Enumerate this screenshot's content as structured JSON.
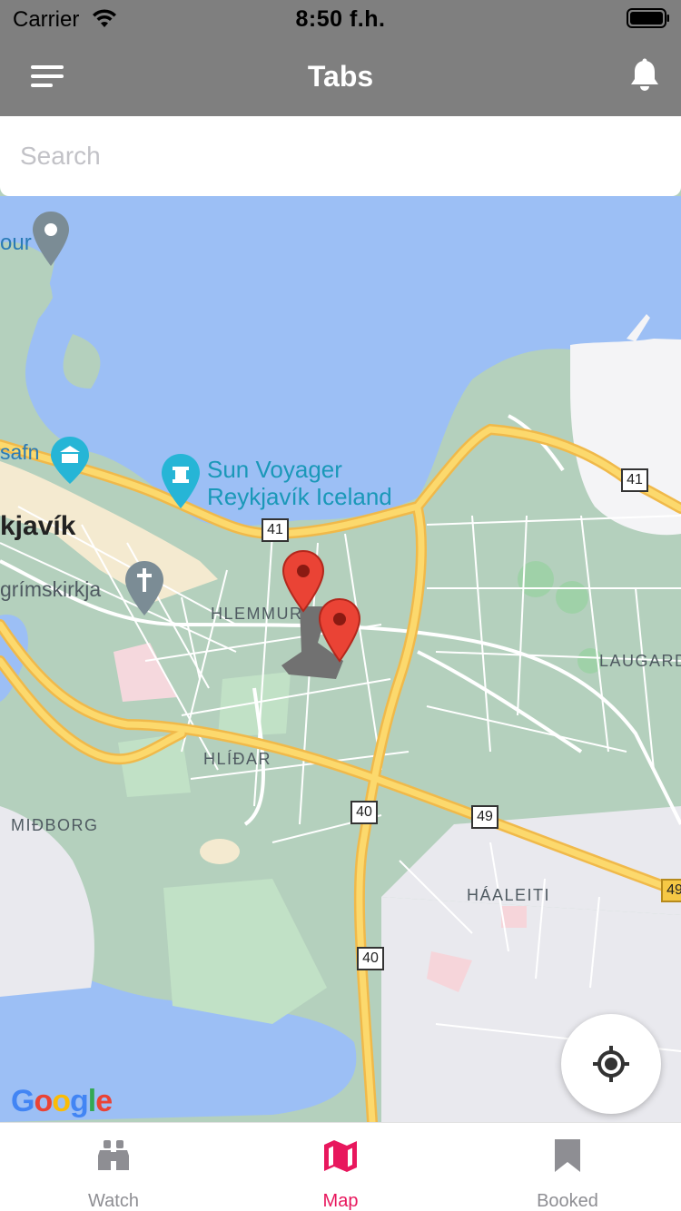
{
  "status_bar": {
    "carrier": "Carrier",
    "time": "8:50 f.h."
  },
  "nav": {
    "title": "Tabs"
  },
  "search": {
    "placeholder": "Search"
  },
  "map": {
    "places": {
      "reykjavik_fragment": "kjavík",
      "tour_fragment": "our",
      "safn_fragment": "safn",
      "sun_voyager_line1": "Sun Voyager",
      "sun_voyager_line2": "Reykjavík Iceland",
      "church": "grímskirkja",
      "hlemmur": "HLEMMUR",
      "hlidar": "HLÍÐAR",
      "midborg": "MIÐBORG",
      "haaleiti": "HÁALEITI",
      "laugard": "LAUGARD"
    },
    "road_shields": [
      "41",
      "41",
      "40",
      "40",
      "49",
      "49"
    ],
    "attribution": "Google"
  },
  "colors": {
    "accent": "#e8175d",
    "nav_bg": "#7f7f7f",
    "tab_inactive": "#8e8e93",
    "water": "#9cbff5",
    "land": "#b4d0bd",
    "road": "#f6c845"
  },
  "tabs": [
    {
      "label": "Watch",
      "icon": "binoculars-icon",
      "active": false
    },
    {
      "label": "Map",
      "icon": "map-icon",
      "active": true
    },
    {
      "label": "Booked",
      "icon": "bookmark-icon",
      "active": false
    }
  ]
}
